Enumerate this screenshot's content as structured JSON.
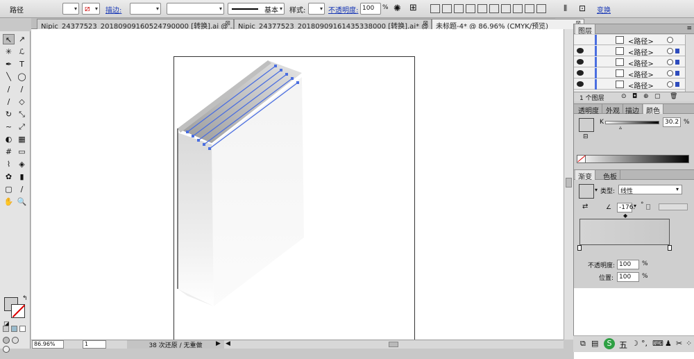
{
  "control_bar": {
    "object_type": "路径",
    "stroke_label": "描边:",
    "stroke_profile": "基本",
    "style_label": "样式:",
    "opacity_label": "不透明度:",
    "opacity_value": "100",
    "opacity_unit": "%",
    "transform_label": "变换"
  },
  "tabs": [
    {
      "label": "Nipic_24377523_20180909160524790000 [转换].ai @ ...",
      "close": "⊠",
      "active": false
    },
    {
      "label": "Nipic_24377523_20180909161435338000 [转换].ai* @ ...",
      "close": "⊠",
      "active": false
    },
    {
      "label": "未标题-4* @ 86.96% (CMYK/预览)",
      "close": "⊠",
      "active": true
    }
  ],
  "toolbox": {
    "tools": [
      "selection-tool",
      "direct-selection-tool",
      "magic-wand-tool",
      "lasso-tool",
      "pen-tool",
      "type-tool",
      "line-tool",
      "ellipse-tool",
      "paintbrush-tool",
      "pencil-tool",
      "blob-brush-tool",
      "eraser-tool",
      "rotate-tool",
      "scale-tool",
      "warp-tool",
      "free-transform-tool",
      "shape-builder-tool",
      "perspective-grid-tool",
      "mesh-tool",
      "gradient-tool",
      "eyedropper-tool",
      "blend-tool",
      "symbol-sprayer-tool",
      "column-graph-tool",
      "artboard-tool",
      "slice-tool",
      "hand-tool",
      "zoom-tool"
    ],
    "tool_glyphs": [
      "↖",
      "↗",
      "✳",
      "ℒ",
      "✒",
      "T",
      "╲",
      "◯",
      "∕",
      "∕",
      "∕",
      "◇",
      "↻",
      "⤡",
      "~",
      "⤢",
      "◐",
      "▦",
      "#",
      "▭",
      "⌇",
      "◈",
      "✿",
      "▮",
      "▢",
      "∕",
      "✋",
      "🔍"
    ]
  },
  "status": {
    "zoom": "86.96%",
    "page": "1",
    "history": "38 次还原 / 无重做"
  },
  "layers_panel": {
    "title": "图层",
    "rows": [
      "<路径>",
      "<路径>",
      "<路径>",
      "<路径>",
      "<路径>"
    ],
    "footer": "1 个图层"
  },
  "color_panel": {
    "tabs": [
      "透明度",
      "外观",
      "描边",
      "颜色"
    ],
    "active_tab": "颜色",
    "k_label": "K",
    "k_value": "30.2",
    "k_unit": "%"
  },
  "gradient_panel": {
    "tabs": [
      "渐变",
      "色板"
    ],
    "active_tab": "渐变",
    "type_label": "类型:",
    "type_value": "线性",
    "angle_value": "-176.",
    "angle_unit": "°",
    "opacity_label": "不透明度:",
    "opacity_value": "100",
    "opacity_unit": "%",
    "position_label": "位置:",
    "position_value": "100",
    "position_unit": "%"
  },
  "taskbar": {
    "ime_label": "五"
  },
  "colors": {
    "accent_blue": "#1636b5",
    "path_blue": "#4a6ee0",
    "swatch_gray": "#cfcfcf"
  }
}
